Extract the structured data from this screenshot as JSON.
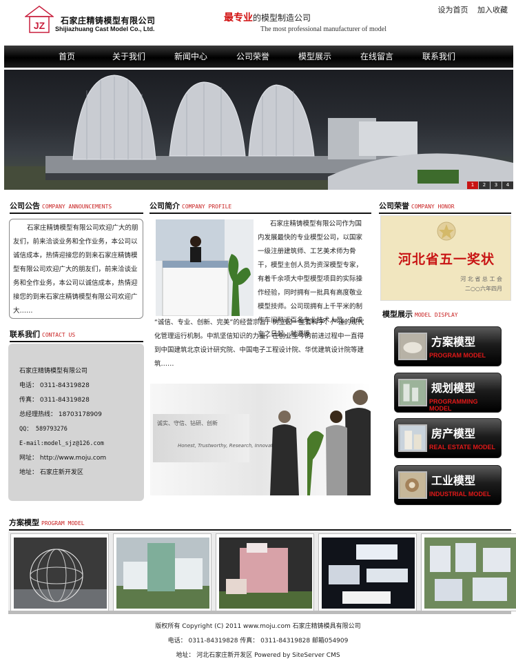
{
  "header": {
    "logo_mark": "JZ",
    "company_cn": "石家庄精铸模型有限公司",
    "company_en": "Shijiazhuang Cast Model Co., Ltd.",
    "slogan_red": "最专业",
    "slogan_rest": "的模型制造公司",
    "slogan_en": "The most professional manufacturer of model",
    "links": [
      "设为首页",
      "加入收藏"
    ]
  },
  "nav": [
    "首页",
    "关于我们",
    "新闻中心",
    "公司荣誉",
    "模型展示",
    "在线留言",
    "联系我们"
  ],
  "banner": {
    "pages": [
      "1",
      "2",
      "3",
      "4"
    ],
    "active_page": 1
  },
  "announcements": {
    "title_cn": "公司公告",
    "title_en": "COMPANY ANNOUNCEMENTS",
    "text": "石家庄精铸模型有限公司欢迎广大的朋友们，前来洽谈业务和全作业务，本公司以诚信成本，热情迎接您的到来石家庄精铸模型有限公司欢迎广大的朋友们，前来洽谈业务和全作业务，本公司以诚信成本，热情迎接您的到来石家庄精铸模型有限公司欢迎广大……"
  },
  "contact": {
    "title_cn": "联系我们",
    "title_en": "CONTACT US",
    "company": "石家庄精铸模型有限公司",
    "phone": "电话： 0311-84319828",
    "fax": "传真： 0311-84319828",
    "hotline": "总经理热线： 18703178909",
    "qq": "QQ： 589793276",
    "email": "E-mail:model_sjz@126.com",
    "website": "网址： http://www.moju.com",
    "address": "地址： 石家庄新开发区"
  },
  "profile": {
    "title_cn": "公司简介",
    "title_en": "COMPANY PROFILE",
    "text1": "石家庄精铸模型有限公司作为国内发展最快的专业模型公司，以国家一级注册建筑师、工艺美术师为骨干，模型主创人员为资深模型专家，有着千余项大中型模型项目的实际操作经验，同时拥有一批具有高度敬业模型技师。公司现拥有上千平米的制作车间和近百名专业技术人员。自成立之日起，就遵循",
    "text2": "“诚信、专业、创新、完美”的经营宗旨，树立起一整套科学、严谨的现代化管理运行机制。中凯坚信知识的力量，在创业至今的前进过程中一直得到中国建筑北京设计研究院、中国电子工程设计院、华优建筑设计院等建筑……",
    "banner_cn": "诚实、守信、钻研、创新",
    "banner_en": "Honest, Trustworthy, Research, Innovation"
  },
  "honor": {
    "title_cn": "公司荣誉",
    "title_en": "COMPANY HONOR",
    "award_title": "河北省五一奖状",
    "award_issuer": "河 北 省 总 工 会",
    "award_date": "二○○六年四月"
  },
  "model_display": {
    "title_cn": "模型展示",
    "title_en": "MODEL DISPLAY",
    "items": [
      {
        "cn": "方案模型",
        "en": "PROGRAM MODEL"
      },
      {
        "cn": "规划模型",
        "en": "PROGRAMMING MODEL"
      },
      {
        "cn": "房产模型",
        "en": "REAL ESTATE MODEL"
      },
      {
        "cn": "工业模型",
        "en": "INDUSTRIAL MODEL"
      }
    ]
  },
  "program_model": {
    "title_cn": "方案模型",
    "title_en": "PROGRAM MODEL"
  },
  "footer": {
    "line1": "版权所有 Copyright (C) 2011 www.moju.com 石家庄精铸模具有限公司",
    "line2": "电话： 0311-84319828 传真： 0311-84319828 邮箱054909",
    "line3": "地址： 河北石家庄新开发区 Powered by SiteServer CMS"
  },
  "colors": {
    "accent_red": "#d10f0f",
    "nav_bg": "#000000",
    "contact_bg": "#d4d4d4"
  }
}
